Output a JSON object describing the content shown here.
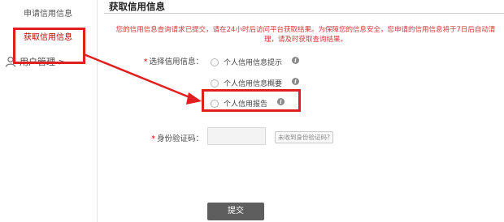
{
  "sidebar": {
    "items": [
      {
        "label": "申请信用信息"
      },
      {
        "label": "获取信用信息"
      },
      {
        "label": "用户管理 >"
      }
    ]
  },
  "page": {
    "title": "获取信用信息",
    "notice": "您的信用信息查询请求已提交，请在24小时后访问平台获取结果。为保障您的信息安全，您申请的信用信息将于7日后自动清理，请及时获取查询结果。"
  },
  "form": {
    "select_label": "选择信用信息：",
    "options": [
      {
        "label": "个人信用信息提示"
      },
      {
        "label": "个人信用信息概要"
      },
      {
        "label": "个人信用报告"
      }
    ],
    "id_code_label": "身份验证码：",
    "id_code_value": "",
    "get_code_link": "未收到身份验证码?",
    "submit_label": "提交"
  },
  "colors": {
    "highlight": "#e02020",
    "notice_text": "#d03a3a",
    "active_nav": "#c40000",
    "submit_bg": "#5e5e5e"
  },
  "icons": {
    "info": "info-icon",
    "user": "user-icon"
  }
}
